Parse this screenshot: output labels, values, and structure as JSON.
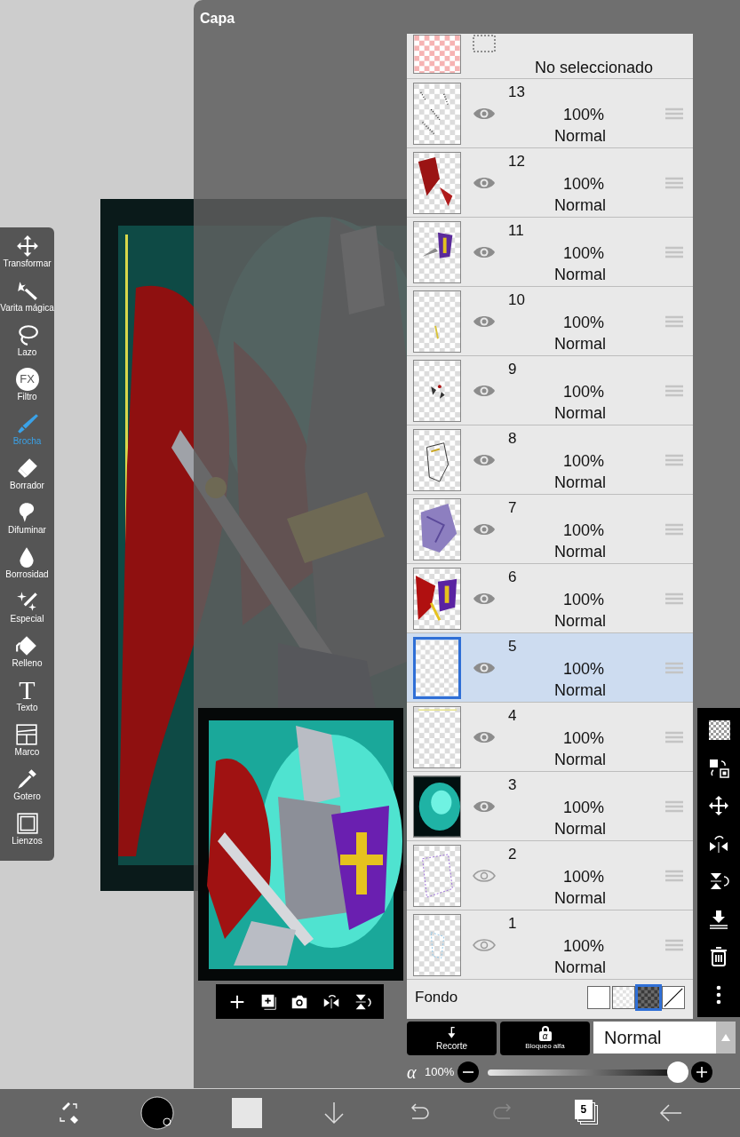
{
  "panel": {
    "title": "Capa"
  },
  "tools": [
    {
      "label": "Transformar",
      "selected": false
    },
    {
      "label": "Varita mágica",
      "selected": false
    },
    {
      "label": "Lazo",
      "selected": false
    },
    {
      "label": "Filtro",
      "selected": false,
      "icon_text": "FX"
    },
    {
      "label": "Brocha",
      "selected": true
    },
    {
      "label": "Borrador",
      "selected": false
    },
    {
      "label": "Difuminar",
      "selected": false
    },
    {
      "label": "Borrosidad",
      "selected": false
    },
    {
      "label": "Especial",
      "selected": false
    },
    {
      "label": "Relleno",
      "selected": false
    },
    {
      "label": "Texto",
      "selected": false,
      "icon_text": "T"
    },
    {
      "label": "Marco",
      "selected": false
    },
    {
      "label": "Gotero",
      "selected": false
    },
    {
      "label": "Lienzos",
      "selected": false
    }
  ],
  "selection_layer": {
    "label": "No seleccionado"
  },
  "layers": [
    {
      "name": "13",
      "opacity": "100%",
      "blend": "Normal",
      "visible": true,
      "selected": false
    },
    {
      "name": "12",
      "opacity": "100%",
      "blend": "Normal",
      "visible": true,
      "selected": false
    },
    {
      "name": "11",
      "opacity": "100%",
      "blend": "Normal",
      "visible": true,
      "selected": false
    },
    {
      "name": "10",
      "opacity": "100%",
      "blend": "Normal",
      "visible": true,
      "selected": false
    },
    {
      "name": "9",
      "opacity": "100%",
      "blend": "Normal",
      "visible": true,
      "selected": false
    },
    {
      "name": "8",
      "opacity": "100%",
      "blend": "Normal",
      "visible": true,
      "selected": false
    },
    {
      "name": "7",
      "opacity": "100%",
      "blend": "Normal",
      "visible": true,
      "selected": false
    },
    {
      "name": "6",
      "opacity": "100%",
      "blend": "Normal",
      "visible": true,
      "selected": false
    },
    {
      "name": "5",
      "opacity": "100%",
      "blend": "Normal",
      "visible": true,
      "selected": true
    },
    {
      "name": "4",
      "opacity": "100%",
      "blend": "Normal",
      "visible": true,
      "selected": false
    },
    {
      "name": "3",
      "opacity": "100%",
      "blend": "Normal",
      "visible": true,
      "selected": false
    },
    {
      "name": "2",
      "opacity": "100%",
      "blend": "Normal",
      "visible": false,
      "selected": false
    },
    {
      "name": "1",
      "opacity": "100%",
      "blend": "Normal",
      "visible": false,
      "selected": false
    }
  ],
  "background": {
    "label": "Fondo",
    "swatches": [
      {
        "kind": "white",
        "selected": false
      },
      {
        "kind": "transparent",
        "selected": false
      },
      {
        "kind": "dark",
        "selected": true
      },
      {
        "kind": "none",
        "selected": false
      }
    ]
  },
  "clipping_button": {
    "label": "Recorte"
  },
  "alpha_lock_button": {
    "label": "Bloqueo alfa",
    "icon_text": "α"
  },
  "blend_mode": {
    "value": "Normal"
  },
  "opacity": {
    "symbol": "α",
    "reading": "100%",
    "level": 1
  },
  "bottom_bar": {
    "layer_count": "5"
  }
}
